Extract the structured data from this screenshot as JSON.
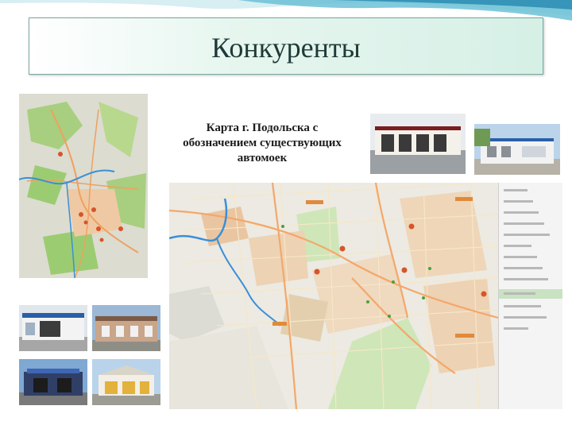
{
  "slide": {
    "title": "Конкуренты",
    "caption": "Карта г. Подольска с обозначением существующих автомоек"
  },
  "colors": {
    "title_bg": "#d6f0e6",
    "title_border": "#7aa7a0",
    "map_green": "#9ccc72",
    "map_road": "#f4a76b",
    "marker": "#d6552a",
    "river": "#3a8fd8"
  },
  "images": {
    "small_map": "overview-map-of-podolsk",
    "large_map": "detailed-city-map-with-carwash-markers",
    "photos": [
      "carwash-building-white-facade",
      "carwash-modular-blue-trim",
      "carwash-blue-entrance",
      "carwash-brick-building",
      "carwash-dark-building",
      "carwash-yellow-gates"
    ]
  },
  "legend": {
    "active_index": 10,
    "items_count": 14
  }
}
